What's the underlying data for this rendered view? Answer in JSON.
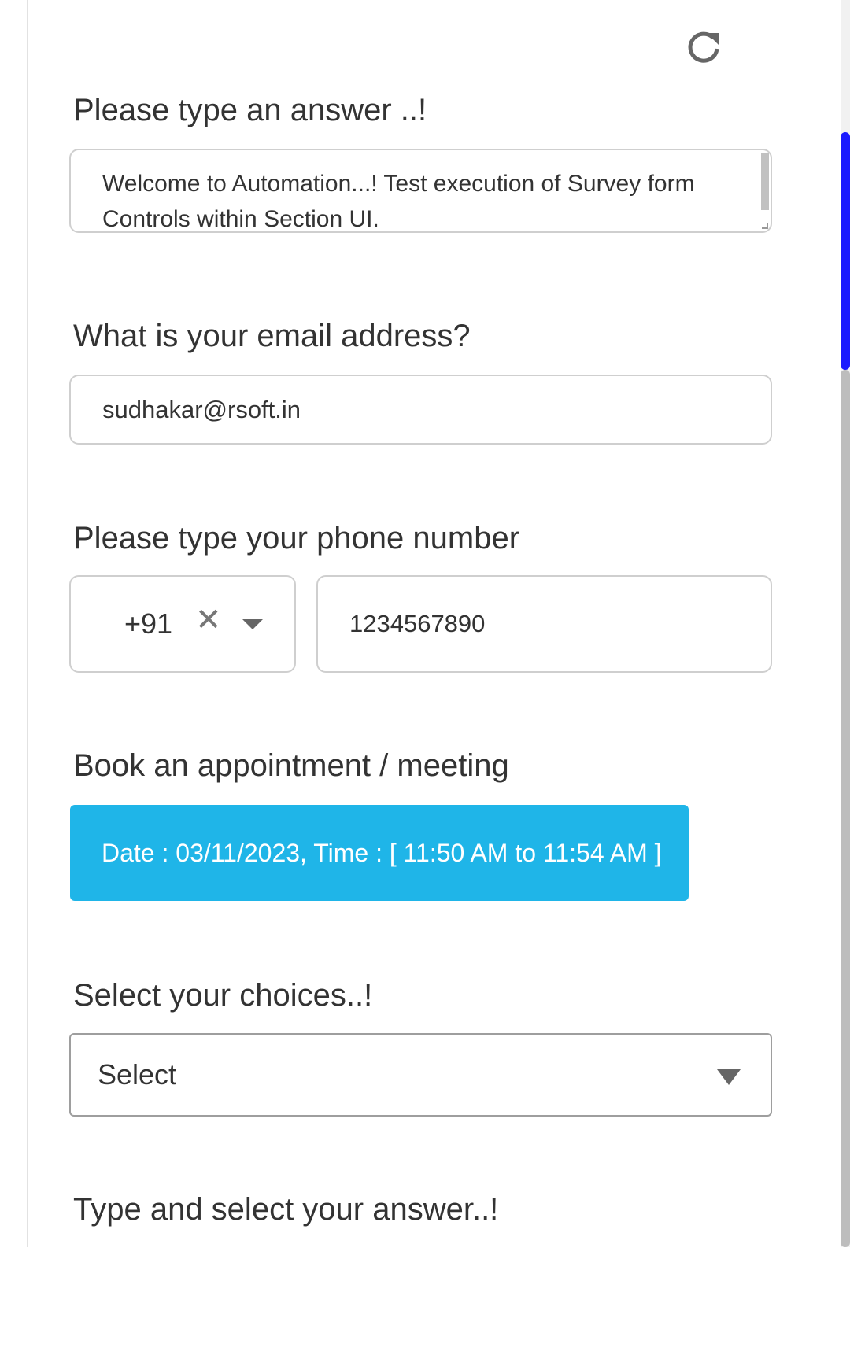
{
  "form": {
    "text_question": {
      "label": "Please type an answer ..!",
      "value": "Welcome to Automation...! Test execution of Survey form Controls within Section UI."
    },
    "email_question": {
      "label": "What is your email address?",
      "value": "sudhakar@rsoft.in"
    },
    "phone_question": {
      "label": "Please type your phone number",
      "country_code": "+91",
      "clear_symbol": "✕",
      "number": "1234567890"
    },
    "appointment_question": {
      "label": "Book an appointment / meeting",
      "value": "Date : 03/11/2023, Time : [ 11:50 AM to 11:54 AM ]"
    },
    "choices_question": {
      "label": "Select your choices..!",
      "selected": "Select"
    },
    "autocomplete_question": {
      "label": "Type and select your answer..!"
    }
  },
  "icons": {
    "refresh": "refresh-icon",
    "clear": "close-icon",
    "dropdown": "chevron-down-icon"
  },
  "colors": {
    "appointment_bg": "#1fb5e8",
    "scroll_thumb": "#1a1aff",
    "text": "#333333",
    "border": "#cfcfcf"
  }
}
